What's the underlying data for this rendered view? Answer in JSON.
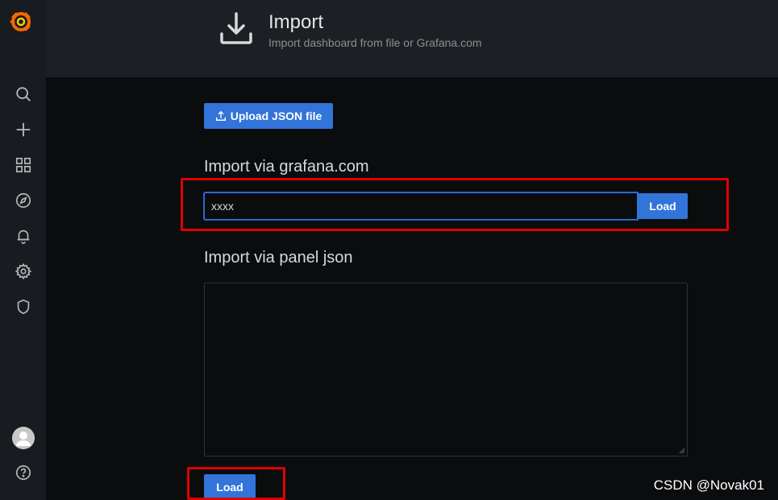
{
  "header": {
    "title": "Import",
    "subtitle": "Import dashboard from file or Grafana.com"
  },
  "sidebar": {
    "items": [
      {
        "name": "search",
        "icon": "search-icon"
      },
      {
        "name": "create",
        "icon": "plus-icon"
      },
      {
        "name": "dashboards",
        "icon": "grid-icon"
      },
      {
        "name": "explore",
        "icon": "compass-icon"
      },
      {
        "name": "alerting",
        "icon": "bell-icon"
      },
      {
        "name": "configuration",
        "icon": "gear-icon"
      },
      {
        "name": "server-admin",
        "icon": "shield-icon"
      }
    ],
    "help_icon": "question-icon"
  },
  "upload": {
    "label": "Upload JSON file"
  },
  "grafana_com": {
    "title": "Import via grafana.com",
    "value": "xxxx",
    "load_label": "Load"
  },
  "panel_json": {
    "title": "Import via panel json",
    "value": "",
    "load_label": "Load"
  },
  "watermark": "CSDN @Novak01",
  "colors": {
    "primary": "#3274d9",
    "annotation": "#e00000",
    "logo": "#f46800"
  }
}
